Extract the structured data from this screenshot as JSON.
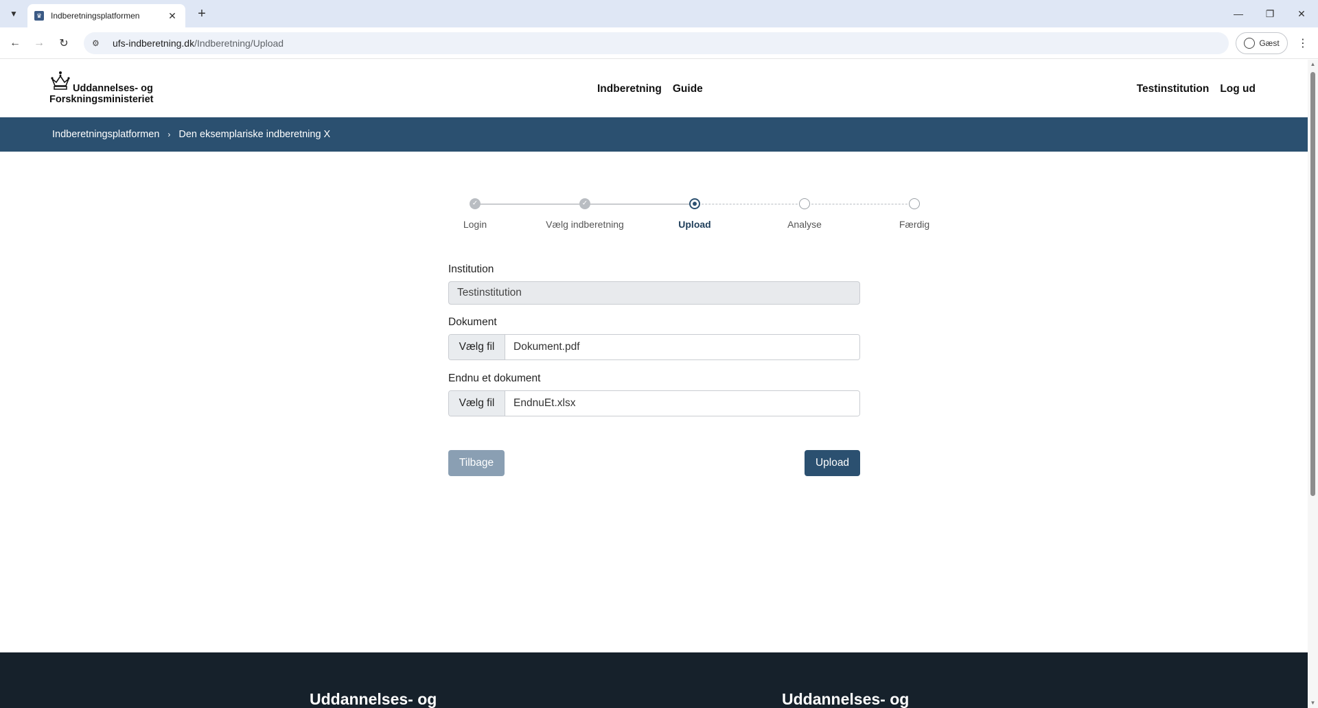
{
  "browser": {
    "tab_title": "Indberetningsplatformen",
    "url_host": "ufs-indberetning.dk",
    "url_path": "/Indberetning/Upload",
    "profile_label": "Gæst"
  },
  "header": {
    "logo_line1": "Uddannelses- og",
    "logo_line2": "Forskningsministeriet",
    "nav": [
      "Indberetning",
      "Guide"
    ],
    "user": "Testinstitution",
    "logout": "Log ud"
  },
  "breadcrumb": [
    "Indberetningsplatformen",
    "Den eksemplariske indberetning X"
  ],
  "stepper": {
    "steps": [
      {
        "label": "Login",
        "state": "done"
      },
      {
        "label": "Vælg indberetning",
        "state": "done"
      },
      {
        "label": "Upload",
        "state": "active"
      },
      {
        "label": "Analyse",
        "state": "todo"
      },
      {
        "label": "Færdig",
        "state": "todo"
      }
    ]
  },
  "form": {
    "institution_label": "Institution",
    "institution_value": "Testinstitution",
    "document_label": "Dokument",
    "document_button": "Vælg fil",
    "document_file": "Dokument.pdf",
    "document2_label": "Endnu et dokument",
    "document2_button": "Vælg fil",
    "document2_file": "EndnuEt.xlsx",
    "back_label": "Tilbage",
    "upload_label": "Upload"
  },
  "footer": {
    "brand_left": "Uddannelses- og",
    "brand_right": "Uddannelses- og"
  },
  "colors": {
    "primary": "#2b5070",
    "footer_bg": "#16212b",
    "disabled_button": "#8a9fb3"
  }
}
